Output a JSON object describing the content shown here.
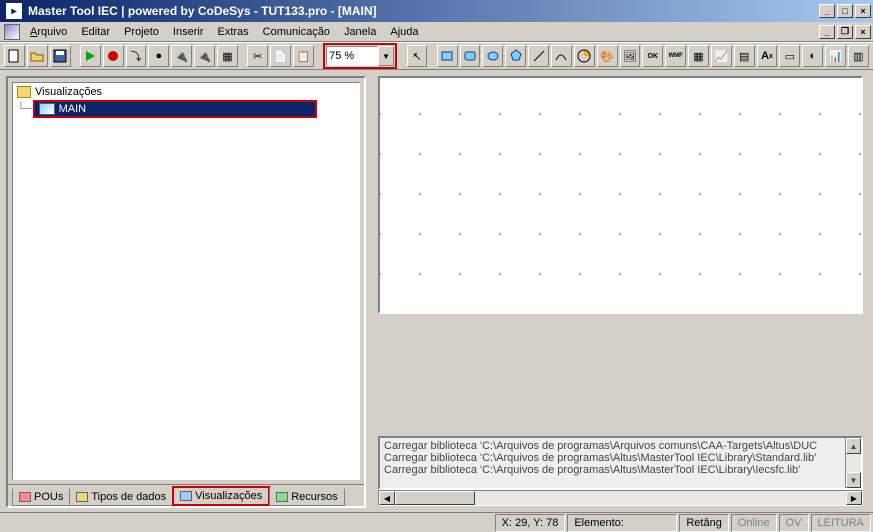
{
  "title": "Master Tool IEC | powered by CoDeSys - TUT133.pro - [MAIN]",
  "menu": {
    "arquivo": "Arquivo",
    "editar": "Editar",
    "projeto": "Projeto",
    "inserir": "Inserir",
    "extras": "Extras",
    "comunicacao": "Comunicação",
    "janela": "Janela",
    "ajuda": "Ajuda"
  },
  "toolbar": {
    "zoom": "75 %"
  },
  "tree": {
    "root": "Visualizações",
    "item": "MAIN"
  },
  "tabs": {
    "pous": "POUs",
    "tipos": "Tipos de dados",
    "visual": "Visualizações",
    "recursos": "Recursos"
  },
  "log": {
    "l1": "Carregar biblioteca 'C:\\Arquivos de programas\\Arquivos comuns\\CAA-Targets\\Altus\\DUC",
    "l2": "Carregar biblioteca 'C:\\Arquivos de programas\\Altus\\MasterTool IEC\\Library\\Standard.lib'",
    "l3": "Carregar biblioteca 'C:\\Arquivos de programas\\Altus\\MasterTool IEC\\Library\\Iecsfc.lib'"
  },
  "status": {
    "coords": "X:   29, Y:   78",
    "elemento": "Elemento:",
    "retang": "Retâng",
    "online": "Online",
    "ov": "OV",
    "leitura": "LEITURA"
  },
  "chart_data": null
}
